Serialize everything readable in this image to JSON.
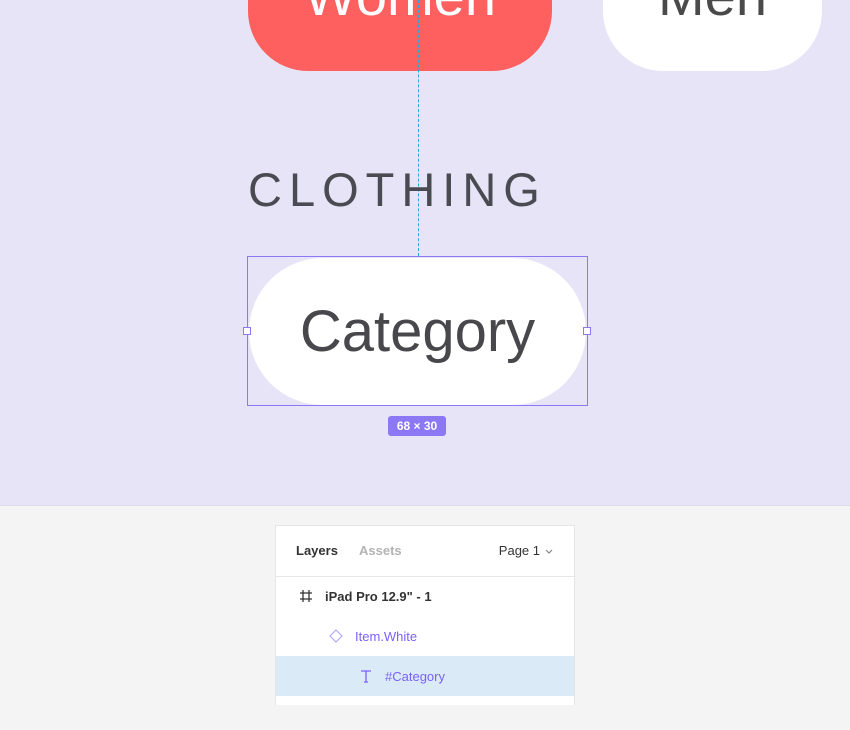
{
  "canvas": {
    "pill_women_label": "Women",
    "pill_men_label": "Men",
    "heading": "CLOTHING",
    "selected_pill_label": "Category",
    "dimension_badge": "68 × 30"
  },
  "layers_panel": {
    "tabs": [
      {
        "label": "Layers",
        "active": true
      },
      {
        "label": "Assets",
        "active": false
      }
    ],
    "page_select": "Page 1",
    "rows": [
      {
        "icon": "frame-hash-icon",
        "label": "iPad Pro 12.9\" - 1",
        "selected": false
      },
      {
        "icon": "component-instance-icon",
        "label": "Item.White",
        "selected": false
      },
      {
        "icon": "text-layer-icon",
        "label": "#Category",
        "selected": true
      }
    ]
  },
  "colors": {
    "canvas_bg": "#e6e4f6",
    "women_pill": "#fe5f5f",
    "selection": "#8c78f5",
    "guide": "#2fa6d8",
    "selected_row": "#daeaf7",
    "component_text": "#7b61ff"
  }
}
